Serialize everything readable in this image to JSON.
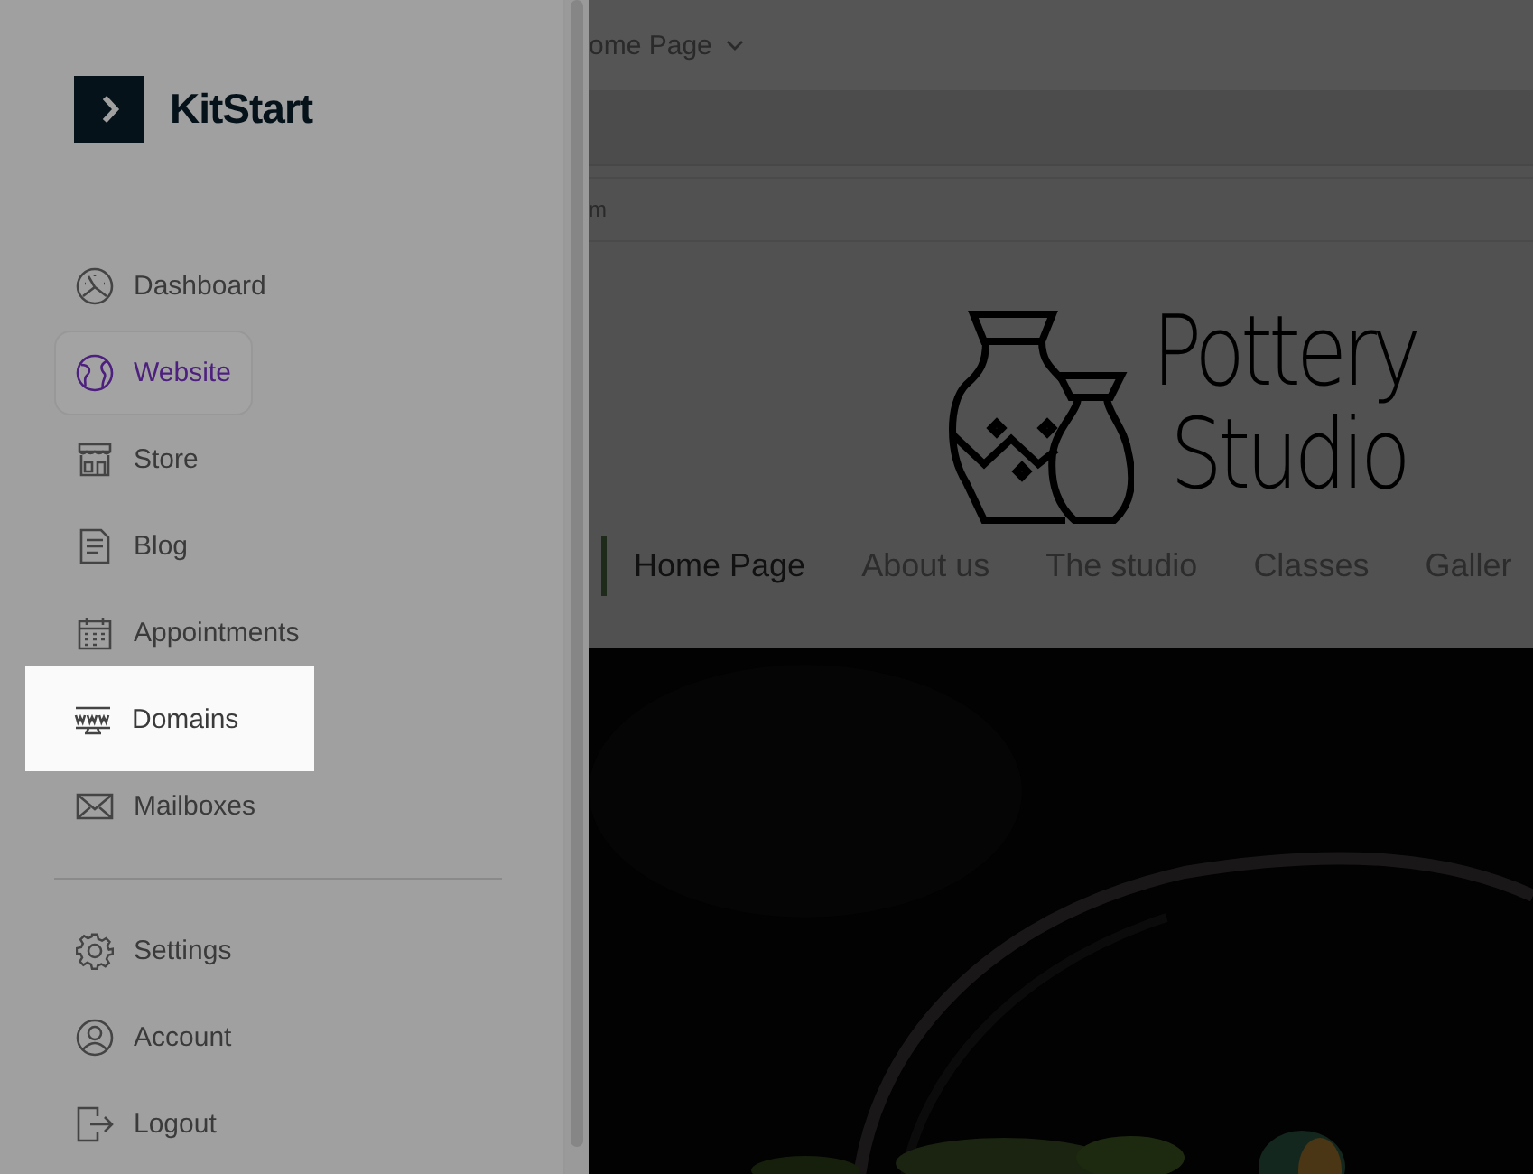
{
  "brand": {
    "name": "KitStart"
  },
  "nav": [
    {
      "label": "Dashboard",
      "selected": false,
      "highlighted": false
    },
    {
      "label": "Website",
      "selected": true,
      "highlighted": false
    },
    {
      "label": "Store",
      "selected": false,
      "highlighted": false
    },
    {
      "label": "Blog",
      "selected": false,
      "highlighted": false
    },
    {
      "label": "Appointments",
      "selected": false,
      "highlighted": false
    },
    {
      "label": "Domains",
      "selected": false,
      "highlighted": true
    },
    {
      "label": "Mailboxes",
      "selected": false,
      "highlighted": false
    }
  ],
  "bottom_nav": [
    {
      "label": "Settings"
    },
    {
      "label": "Account"
    },
    {
      "label": "Logout"
    }
  ],
  "page": {
    "page_selector": "ome Page",
    "address_fragment": "m",
    "site": {
      "logo_line_1": "Pottery",
      "logo_line_2": "Studio",
      "menu": [
        {
          "label": "Home Page",
          "selected": true
        },
        {
          "label": "About us",
          "selected": false
        },
        {
          "label": "The studio",
          "selected": false
        },
        {
          "label": "Classes",
          "selected": false
        },
        {
          "label": "Galler",
          "selected": false
        }
      ]
    }
  }
}
